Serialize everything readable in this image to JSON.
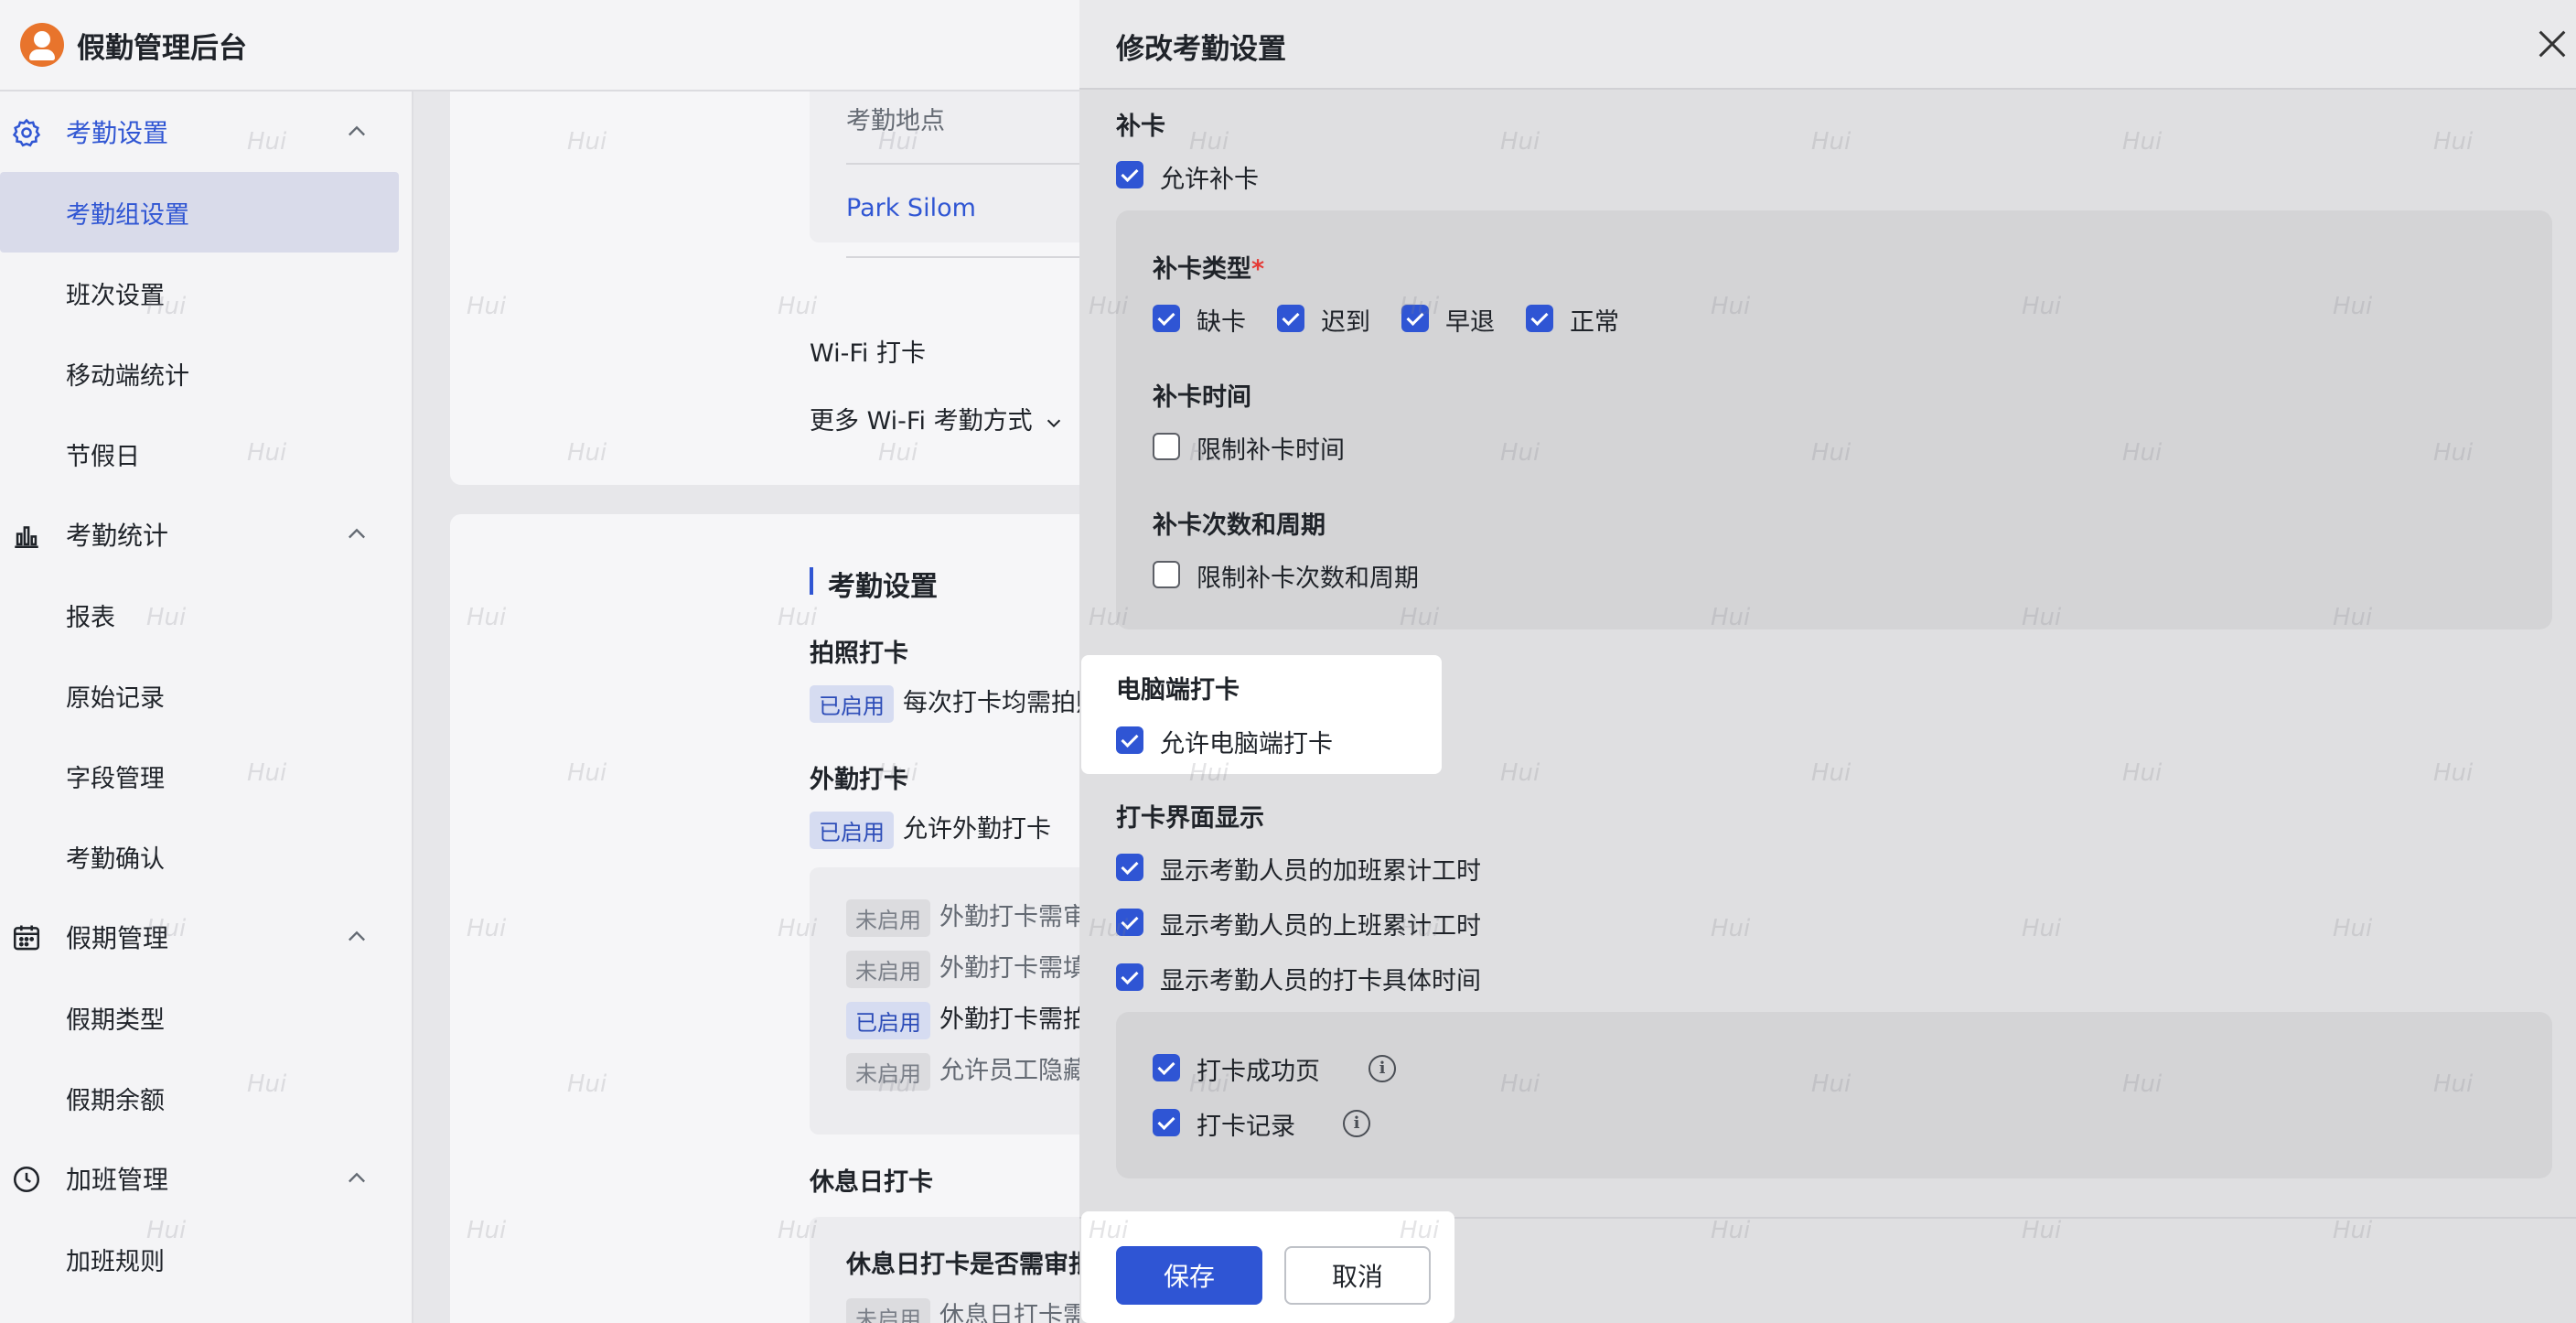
{
  "app": {
    "title": "假勤管理后台"
  },
  "sidebar": {
    "groups": [
      {
        "label": "考勤设置",
        "items": [
          "考勤组设置",
          "班次设置",
          "移动端统计",
          "节假日"
        ]
      },
      {
        "label": "考勤统计",
        "items": [
          "报表",
          "原始记录",
          "字段管理",
          "考勤确认"
        ]
      },
      {
        "label": "假期管理",
        "items": [
          "假期类型",
          "假期余额"
        ]
      },
      {
        "label": "加班管理",
        "items": [
          "加班规则"
        ]
      }
    ]
  },
  "content": {
    "location_label": "考勤地点",
    "location_value": "Park Silom",
    "wifi_title": "Wi-Fi 打卡",
    "wifi_more": "更多 Wi-Fi 考勤方式",
    "section_title": "考勤设置",
    "photo_title": "拍照打卡",
    "photo_tag": "已启用",
    "photo_text": "每次打卡均需拍照",
    "field_title": "外勤打卡",
    "field_tag": "已启用",
    "field_text": "允许外勤打卡",
    "field_rules": [
      {
        "tag": "未启用",
        "text": "外勤打卡需审批"
      },
      {
        "tag": "未启用",
        "text": "外勤打卡需填写"
      },
      {
        "tag": "已启用",
        "text": "外勤打卡需拍照"
      },
      {
        "tag": "未启用",
        "text": "允许员工隐藏详"
      }
    ],
    "rest_title": "休息日打卡",
    "rest_sub": "休息日打卡是否需审批",
    "rest_tag": "未启用",
    "rest_text": "休息日打卡需审"
  },
  "panel": {
    "title": "修改考勤设置",
    "makeup": {
      "title": "补卡",
      "allow_label": "允许补卡",
      "type_label": "补卡类型",
      "required_mark": "*",
      "types": [
        "缺卡",
        "迟到",
        "早退",
        "正常"
      ],
      "time_label": "补卡时间",
      "time_option": "限制补卡时间",
      "count_label": "补卡次数和周期",
      "count_option": "限制补卡次数和周期"
    },
    "pc": {
      "title": "电脑端打卡",
      "option": "允许电脑端打卡"
    },
    "display": {
      "title": "打卡界面显示",
      "options": [
        "显示考勤人员的加班累计工时",
        "显示考勤人员的上班累计工时",
        "显示考勤人员的打卡具体时间"
      ],
      "sub_options": [
        "打卡成功页",
        "打卡记录"
      ]
    },
    "buttons": {
      "save": "保存",
      "cancel": "取消"
    }
  },
  "watermark": "Hui",
  "colors": {
    "primary": "#2f55d4",
    "required": "#e53935",
    "link": "#3056d3"
  }
}
